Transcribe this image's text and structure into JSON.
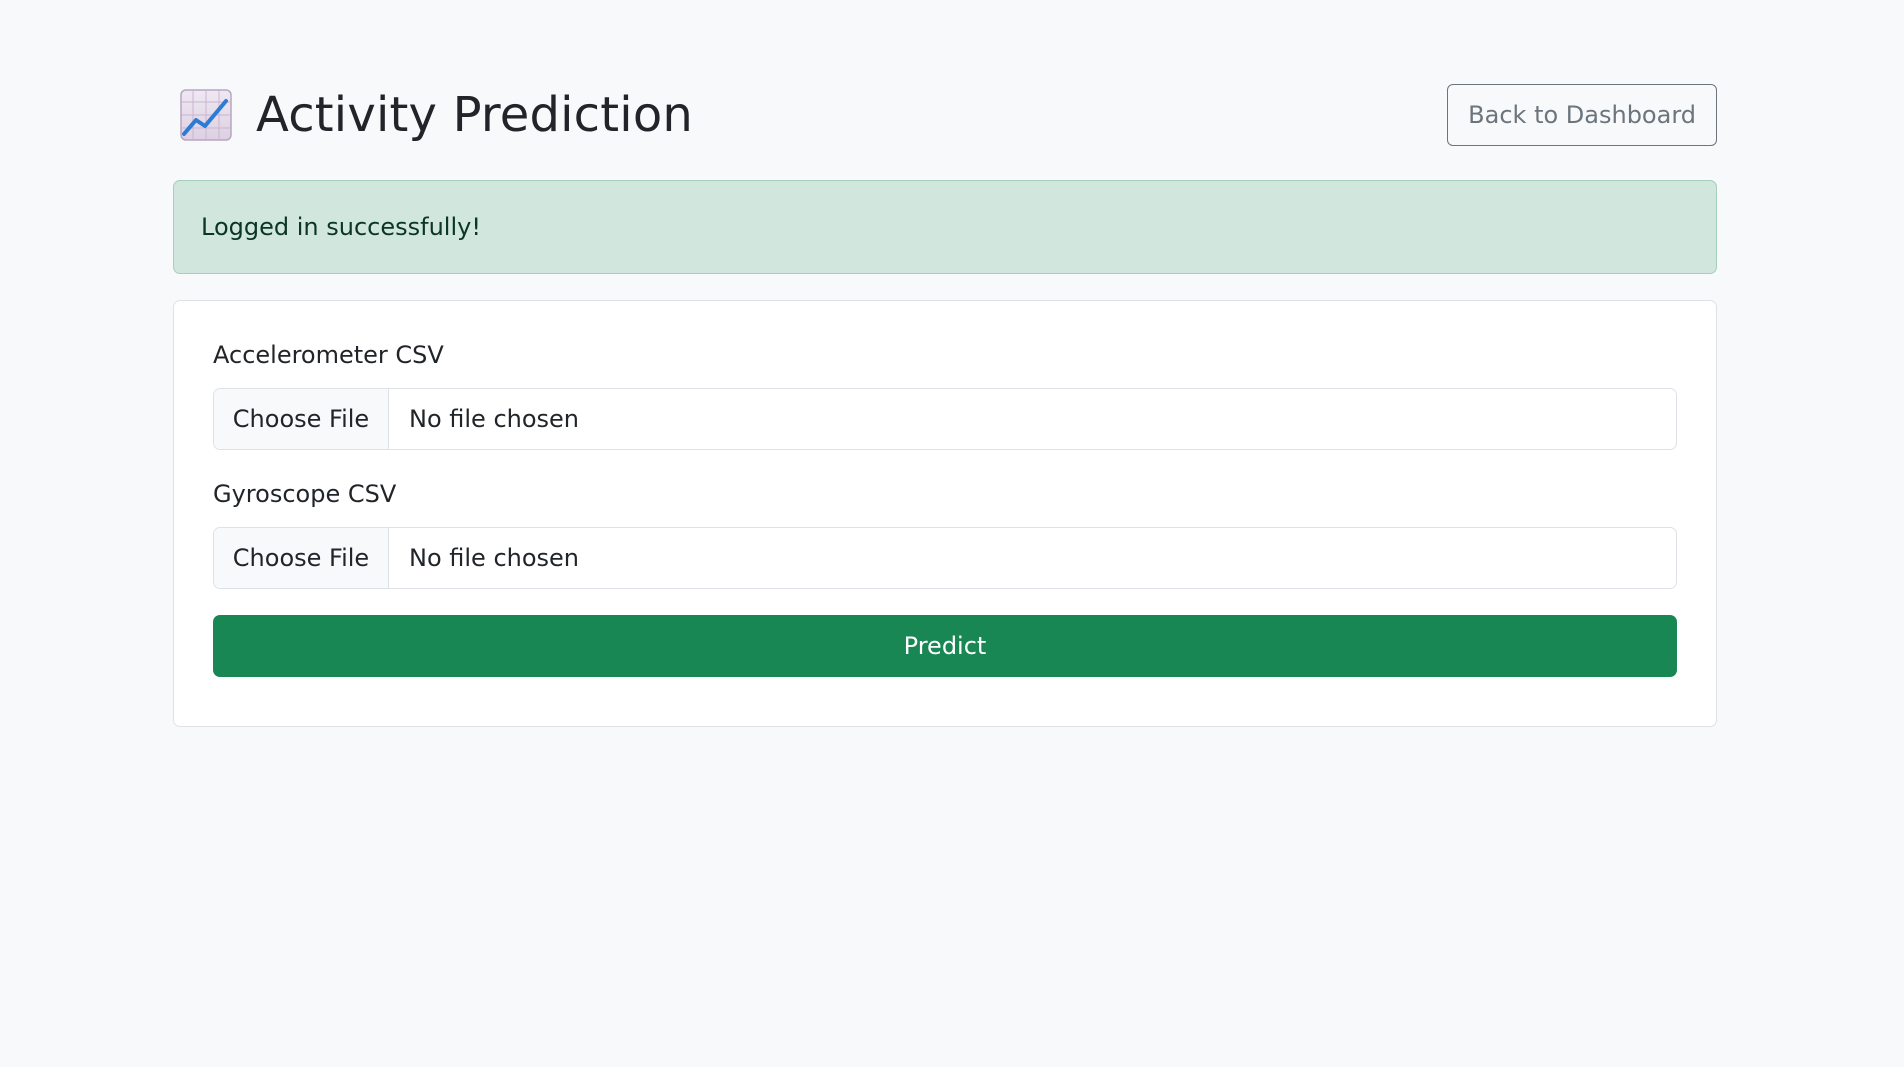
{
  "header": {
    "icon": "chart-increasing-icon",
    "title": "Activity Prediction",
    "back_button": "Back to Dashboard"
  },
  "alert": {
    "message": "Logged in successfully!",
    "color_bg": "#d1e7dd",
    "color_text": "#0a3622"
  },
  "form": {
    "fields": [
      {
        "label": "Accelerometer CSV",
        "choose_label": "Choose File",
        "status": "No file chosen"
      },
      {
        "label": "Gyroscope CSV",
        "choose_label": "Choose File",
        "status": "No file chosen"
      }
    ],
    "submit_label": "Predict",
    "submit_color": "#198754"
  }
}
